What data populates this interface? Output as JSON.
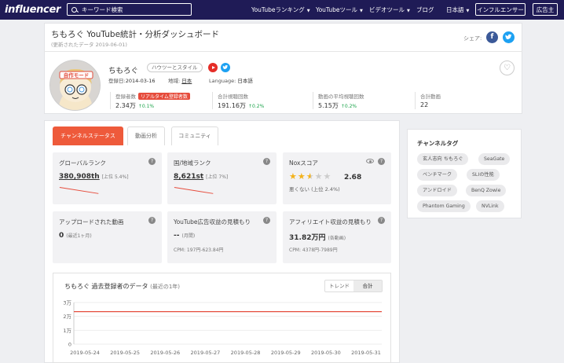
{
  "nav": {
    "logo": "influencer",
    "search_placeholder": "キーワード検索",
    "menu": [
      {
        "label": "YouTubeランキング"
      },
      {
        "label": "YouTubeツール"
      },
      {
        "label": "ビデオツール"
      },
      {
        "label": "ブログ"
      },
      {
        "label": "日本語"
      }
    ],
    "influencer_button": "インフルエンサー",
    "advertiser_button": "広告主"
  },
  "header": {
    "title": "ちもろぐ YouTube統計・分析ダッシュボード",
    "updated": "(更新されたデータ 2019-06-01)",
    "share_label": "シェア:"
  },
  "channel": {
    "name": "ちもろぐ",
    "category": "ハウツーとスタイル",
    "registered_label": "登録日:",
    "registered": "2014-03-16",
    "region_label": "地域:",
    "region": "日本",
    "language_label": "Language:",
    "language": "日本語",
    "avatar_text": "自作モード"
  },
  "stats": [
    {
      "label": "登録者数",
      "badge": "リアルタイム登録者数",
      "value": "2.34万",
      "change": "↑0.1%"
    },
    {
      "label": "合計視聴回数",
      "value": "191.16万",
      "change": "↑0.2%"
    },
    {
      "label": "動画の平均視聴回数",
      "value": "5.15万",
      "change": "↑0.2%"
    },
    {
      "label": "合計動画",
      "value": "22"
    }
  ],
  "tabs": [
    "チャンネルステータス",
    "動画分析",
    "コミュニティ"
  ],
  "boxes": {
    "global_rank": {
      "title": "グローバルランク",
      "value": "380,908th",
      "note": "[上位 5.4%]"
    },
    "country_rank": {
      "title": "国/地域ランク",
      "value": "8,621st",
      "note": "[上位 7%]"
    },
    "nox_score": {
      "title": "Noxスコア",
      "score": "2.68",
      "rating": 2.5,
      "sub": "悪くない (上位 2.4%)"
    },
    "uploads": {
      "title": "アップロードされた動画",
      "value": "0",
      "note": "(最近1ヶ月)"
    },
    "ad_revenue": {
      "title": "YouTube広告収益の見積もり",
      "value": "--",
      "note": "(月間)",
      "cpm": "CPM: 197円-623.84円"
    },
    "affiliate": {
      "title": "アフィリエイト収益の見積もり",
      "value": "31.82万円",
      "note": "(各動画)",
      "cpm": "CPM: 4378円-7989円"
    }
  },
  "chart": {
    "title": "ちもろぐ 過去登録者のデータ",
    "period": "(最近の1年)",
    "toggle": [
      "トレンド",
      "合計"
    ]
  },
  "chart_data": {
    "type": "line",
    "title": "ちもろぐ 過去登録者のデータ",
    "x": [
      "2019-05-24",
      "2019-05-25",
      "2019-05-26",
      "2019-05-27",
      "2019-05-28",
      "2019-05-29",
      "2019-05-30",
      "2019-05-31"
    ],
    "y_ticks": [
      "0",
      "1万",
      "2万",
      "3万"
    ],
    "ylim": [
      0,
      30000
    ],
    "series": [
      {
        "values": [
          23400,
          23400,
          23400,
          23400,
          23400,
          23400,
          23400,
          23400
        ],
        "color": "#e64c3c"
      }
    ],
    "grid": true
  },
  "tags": {
    "title": "チャンネルタグ",
    "items": [
      "玄人志向 ちもろぐ",
      "SeaGate",
      "ベンチマーク",
      "SLIの性能",
      "アンドロイド",
      "BenQ Zowie",
      "Phantom Gaming",
      "NVLink"
    ]
  },
  "colors": {
    "nav_bg": "#1f1b56",
    "accent": "#ee5a3b",
    "line": "#e64c3c",
    "up": "#1aa34a"
  }
}
